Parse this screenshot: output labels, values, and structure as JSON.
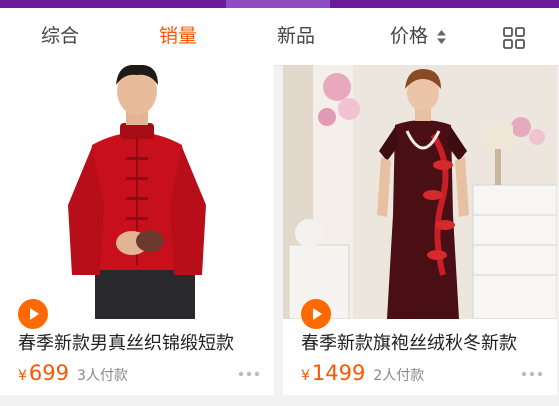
{
  "sort_bar": {
    "tabs": [
      {
        "label": "综合",
        "active": false
      },
      {
        "label": "销量",
        "active": true
      },
      {
        "label": "新品",
        "active": false
      },
      {
        "label": "价格",
        "active": false
      }
    ],
    "price_sort_icon": "up-down-arrows-icon",
    "view_toggle_icon": "grid-view-icon"
  },
  "products": [
    {
      "title": "春季新款男真丝织锦缎短款",
      "currency": "¥",
      "price": "699",
      "sold": "3人付款",
      "video_icon": "play-icon",
      "more_icon": "more-dots-icon"
    },
    {
      "title": "春季新款旗袍丝绒秋冬新款",
      "currency": "¥",
      "price": "1499",
      "sold": "2人付款",
      "video_icon": "play-icon",
      "more_icon": "more-dots-icon"
    }
  ],
  "colors": {
    "accent": "#ff5500",
    "header_bar": "#6a1a9a",
    "play_button": "#ff6a00"
  }
}
